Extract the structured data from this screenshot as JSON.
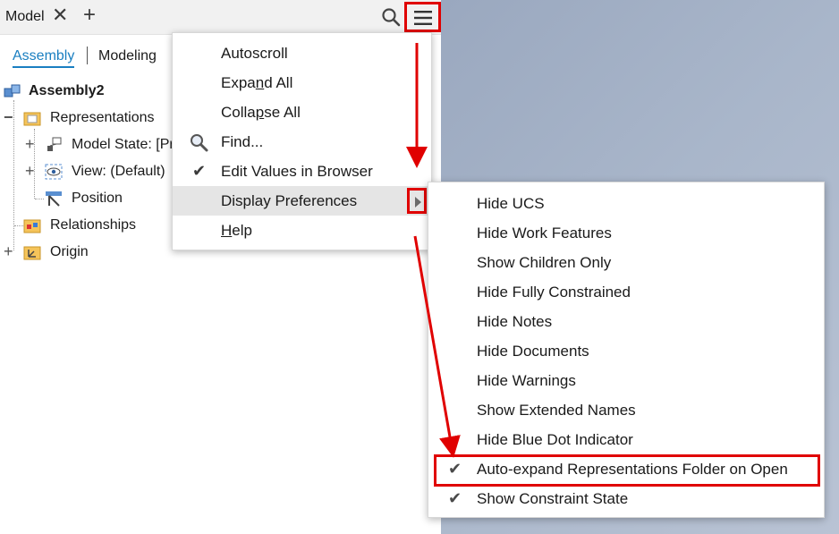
{
  "tabbar": {
    "tab_label": "Model",
    "close_glyph": "✕",
    "add_glyph": "+",
    "search_icon": "search-icon",
    "menu_icon": "hamburger-menu-icon"
  },
  "subtabs": {
    "active": "Assembly",
    "inactive": "Modeling"
  },
  "tree": {
    "root": "Assembly2",
    "representations": "Representations",
    "model_state": "Model State: [Pr",
    "view": "View: (Default)",
    "position": "Position",
    "relationships": "Relationships",
    "origin": "Origin"
  },
  "main_menu": {
    "autoscroll": "Autoscroll",
    "expand_all_pre": "Expa",
    "expand_all_u": "n",
    "expand_all_post": "d All",
    "collapse_all_pre": "Colla",
    "collapse_all_u": "p",
    "collapse_all_post": "se All",
    "find": "Find...",
    "edit_values": "Edit Values in Browser",
    "display_prefs": "Display Preferences",
    "help_u": "H",
    "help_post": "elp",
    "check_glyph": "✔"
  },
  "sub_menu": {
    "items": [
      "Hide UCS",
      "Hide Work Features",
      "Show Children Only",
      "Hide Fully Constrained",
      "Hide Notes",
      "Hide Documents",
      "Hide Warnings",
      "Show Extended Names",
      "Hide Blue Dot Indicator",
      "Auto-expand Representations Folder on Open",
      "Show Constraint State"
    ],
    "check_glyph": "✔"
  },
  "colors": {
    "highlight_box": "#e00000",
    "active_tab": "#1a7fc1",
    "viewport": "#a9b6ca"
  }
}
